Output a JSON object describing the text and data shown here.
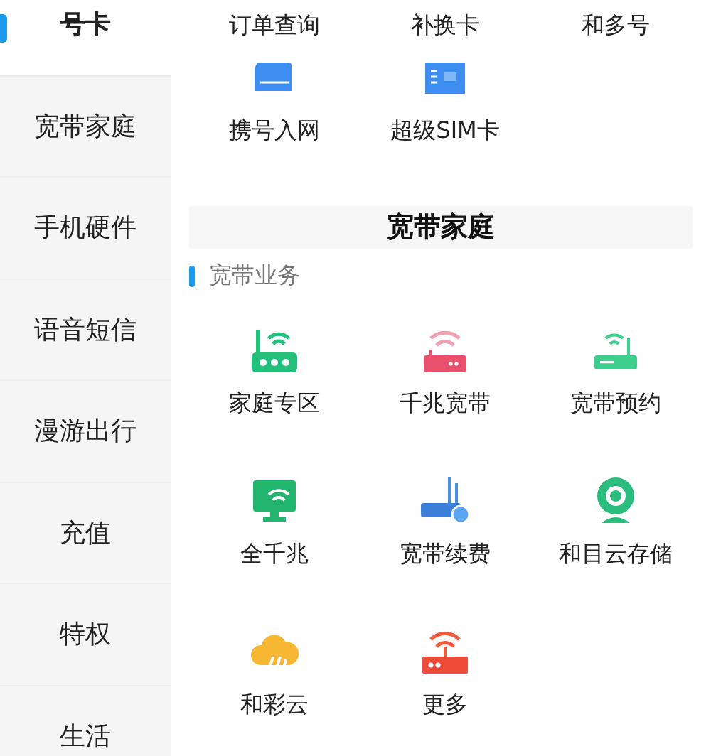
{
  "sidebar": {
    "items": [
      {
        "label": "号卡",
        "selected": true
      },
      {
        "label": "宽带家庭",
        "selected": false
      },
      {
        "label": "手机硬件",
        "selected": false
      },
      {
        "label": "语音短信",
        "selected": false
      },
      {
        "label": "漫游出行",
        "selected": false
      },
      {
        "label": "充值",
        "selected": false
      },
      {
        "label": "特权",
        "selected": false
      },
      {
        "label": "生活",
        "selected": false
      }
    ]
  },
  "card_section": {
    "items": [
      {
        "label": "订单查询",
        "kind": "hidden"
      },
      {
        "label": "补换卡",
        "kind": "hidden"
      },
      {
        "label": "和多号",
        "kind": "hidden"
      },
      {
        "label": "携号入网",
        "kind": "sim"
      },
      {
        "label": "超级SIM卡",
        "kind": "nfc"
      }
    ]
  },
  "broadband": {
    "title": "宽带家庭",
    "group": "宽带业务",
    "items": [
      {
        "label": "家庭专区",
        "kind": "router"
      },
      {
        "label": "千兆宽带",
        "kind": "modem"
      },
      {
        "label": "宽带预约",
        "kind": "gateway"
      },
      {
        "label": "全千兆",
        "kind": "screen"
      },
      {
        "label": "宽带续费",
        "kind": "renew"
      },
      {
        "label": "和目云存储",
        "kind": "camera"
      },
      {
        "label": "和彩云",
        "kind": "cloud"
      },
      {
        "label": "更多",
        "kind": "more"
      }
    ]
  }
}
